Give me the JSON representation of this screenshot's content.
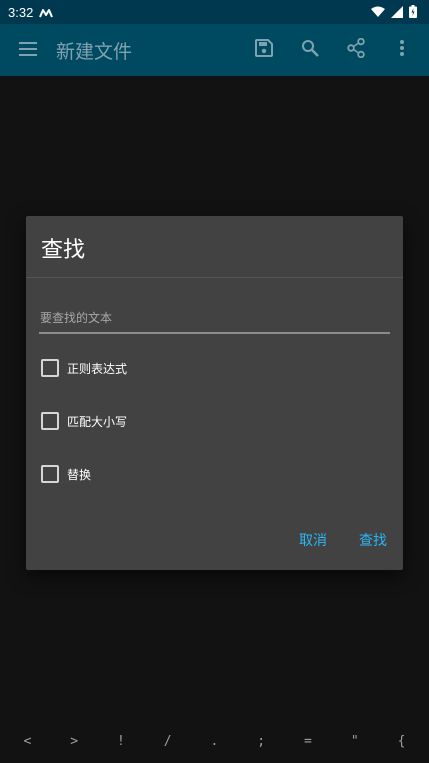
{
  "status_bar": {
    "time": "3:32",
    "notification_icon": "m-logo-icon",
    "icons": [
      "wifi-icon",
      "signal-icon",
      "battery-icon"
    ]
  },
  "app_bar": {
    "title": "新建文件",
    "menu_icon": "hamburger-menu-icon",
    "actions": [
      "save-icon",
      "search-icon",
      "share-icon",
      "more-vert-icon"
    ]
  },
  "dialog": {
    "title": "查找",
    "search_placeholder": "要查找的文本",
    "search_value": "",
    "options": [
      {
        "label": "正则表达式",
        "checked": false
      },
      {
        "label": "匹配大小写",
        "checked": false
      },
      {
        "label": "替换",
        "checked": false
      }
    ],
    "cancel_label": "取消",
    "find_label": "查找"
  },
  "symbol_bar": {
    "keys": [
      "<",
      ">",
      "!",
      "/",
      ".",
      ";",
      "=",
      "\"",
      "{"
    ]
  },
  "colors": {
    "status_bar": "#00384f",
    "app_bar": "#004a61",
    "dialog_bg": "#424242",
    "accent": "#29b6f6",
    "background": "#121212"
  }
}
